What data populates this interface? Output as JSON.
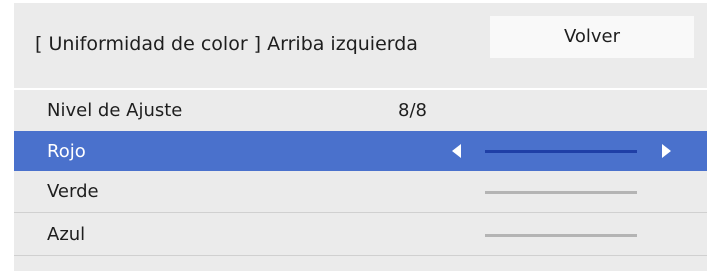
{
  "header": {
    "title": "[ Uniformidad de color ] Arriba izquierda",
    "back_label": "Volver"
  },
  "rows": [
    {
      "label": "Nivel de Ajuste",
      "value": "8/8"
    },
    {
      "label": "Rojo",
      "selected": true
    },
    {
      "label": "Verde"
    },
    {
      "label": "Azul"
    }
  ],
  "icons": {
    "decrease": "triangle-left-icon",
    "increase": "triangle-right-icon"
  },
  "colors": {
    "panel_background": "#ebebeb",
    "selection": "#4a71cc",
    "selected_track": "#1f3fa6",
    "track": "#b4b4b4",
    "button_background": "#f9f9f9"
  }
}
